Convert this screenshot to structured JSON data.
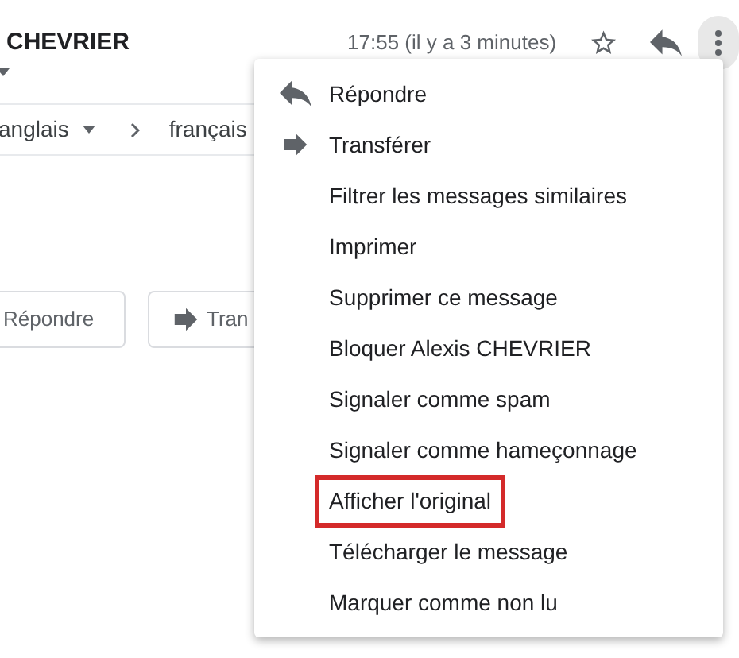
{
  "sender": {
    "name": "CHEVRIER"
  },
  "header": {
    "time": "17:55 (il y a 3 minutes)",
    "more_pressed": true
  },
  "translation_bar": {
    "source_language": "anglais",
    "target_language": "français"
  },
  "reply_buttons": [
    {
      "label": "Répondre",
      "kind": "plain"
    },
    {
      "label": "Tran",
      "kind": "forward"
    }
  ],
  "menu": {
    "items": [
      {
        "label": "Répondre",
        "kind": "reply",
        "highlighted": false
      },
      {
        "label": "Transférer",
        "kind": "forward",
        "highlighted": false
      },
      {
        "label": "Filtrer les messages similaires",
        "kind": "plain",
        "highlighted": false
      },
      {
        "label": "Imprimer",
        "kind": "plain",
        "highlighted": false
      },
      {
        "label": "Supprimer ce message",
        "kind": "plain",
        "highlighted": false
      },
      {
        "label": "Bloquer Alexis CHEVRIER",
        "kind": "plain",
        "highlighted": false
      },
      {
        "label": "Signaler comme spam",
        "kind": "plain",
        "highlighted": false
      },
      {
        "label": "Signaler comme hameçonnage",
        "kind": "plain",
        "highlighted": false
      },
      {
        "label": "Afficher l'original",
        "kind": "plain",
        "highlighted": true
      },
      {
        "label": "Télécharger le message",
        "kind": "plain",
        "highlighted": false
      },
      {
        "label": "Marquer comme non lu",
        "kind": "plain",
        "highlighted": false
      }
    ]
  }
}
